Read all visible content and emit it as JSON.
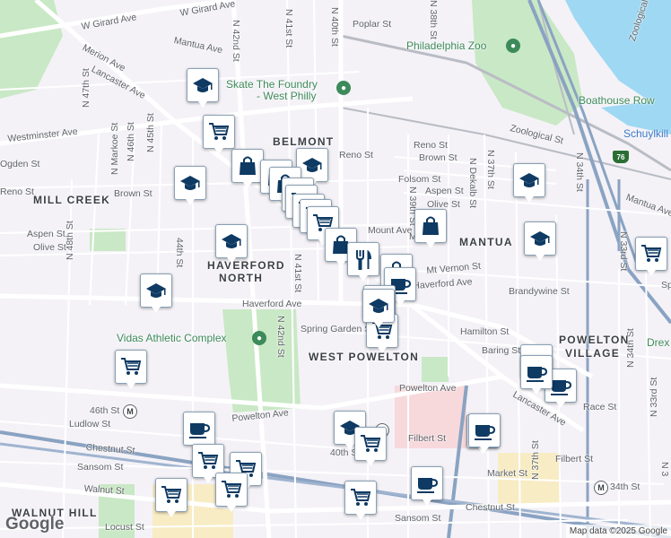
{
  "map": {
    "credits": "Map data ©2025 Google",
    "logo": "Google",
    "colors": {
      "background": "#f4f2f7",
      "park": "#c9e8c5",
      "water": "#9ed8f3",
      "major_road": "#ffffff",
      "highway": "#8aa3c2",
      "rail": "#b9bcc4",
      "marker_icon": "#0e3a63"
    },
    "street_labels": [
      "W Girard Ave",
      "W Girard Ave",
      "Mantua Ave",
      "Merion Ave",
      "Lancaster Ave",
      "Poplar St",
      "Westminster Ave",
      "Ogden St",
      "Reno St",
      "Brown St",
      "Folsom St",
      "Aspen St",
      "Olive St",
      "Mt Vernon St",
      "Haverford Ave",
      "Haverford Ave",
      "Brandywine St",
      "Spring Garden St",
      "Hamilton St",
      "Baring St",
      "Powelton Ave",
      "Powelton Ave",
      "Race St",
      "Lancaster Ave",
      "Ludlow St",
      "Chestnut St",
      "Filbert St",
      "Filbert St",
      "Sansom St",
      "Walnut St",
      "Locust St",
      "Market St",
      "Chestnut St",
      "Sansom St",
      "Zoological St",
      "Mantua Ave",
      "Brown St",
      "Spring",
      "Aspen St",
      "Olive St",
      "Reno St",
      "Reno St",
      "Mount Ave",
      "Mt",
      "N 48th St",
      "N 47th St",
      "N Markoe St",
      "N 46th St",
      "N 45th St",
      "44th St",
      "N 42nd St",
      "N 41st St",
      "N 40th St",
      "N 41st St",
      "N 42nd St",
      "N 39th St",
      "N Dekalb St",
      "N 37th St",
      "N 34th St",
      "N 33rd St",
      "N 34th St",
      "N 37th St",
      "N 33rd St",
      "46th St",
      "40th St",
      "34th St",
      "N 38th St",
      "Zoological",
      "N 3"
    ],
    "neighborhoods": [
      "BELMONT",
      "MILL CREEK",
      "HAVERFORD",
      "NORTH",
      "MANTUA",
      "WEST POWELTON",
      "POWELTON",
      "VILLAGE",
      "WALNUT HILL"
    ],
    "pois": [
      "Philadelphia Zoo",
      "Skate The Foundry",
      "- West Philly",
      "Vidas Athletic Complex",
      "Boathouse Row",
      "Drex"
    ],
    "water_labels": [
      "Schuylkill R"
    ],
    "stations": [
      {
        "label": "46th St",
        "badge": "M"
      },
      {
        "label": "40th St",
        "badge": "M"
      },
      {
        "label": "34th St",
        "badge": "M"
      }
    ],
    "highway_shield": "76",
    "markers": [
      {
        "type": "school"
      },
      {
        "type": "grocery"
      },
      {
        "type": "shopping"
      },
      {
        "type": "school"
      },
      {
        "type": "shopping"
      },
      {
        "type": "shopping"
      },
      {
        "type": "school"
      },
      {
        "type": "grocery"
      },
      {
        "type": "grocery"
      },
      {
        "type": "grocery"
      },
      {
        "type": "grocery"
      },
      {
        "type": "grocery"
      },
      {
        "type": "shopping"
      },
      {
        "type": "restaurant"
      },
      {
        "type": "shopping"
      },
      {
        "type": "cafe"
      },
      {
        "type": "school"
      },
      {
        "type": "grocery"
      },
      {
        "type": "school"
      },
      {
        "type": "school"
      },
      {
        "type": "school"
      },
      {
        "type": "shopping"
      },
      {
        "type": "school"
      },
      {
        "type": "grocery"
      },
      {
        "type": "grocery"
      },
      {
        "type": "cafe"
      },
      {
        "type": "cafe"
      },
      {
        "type": "cafe"
      },
      {
        "type": "school"
      },
      {
        "type": "cafe"
      },
      {
        "type": "grocery"
      },
      {
        "type": "grocery"
      },
      {
        "type": "grocery"
      },
      {
        "type": "grocery"
      },
      {
        "type": "grocery"
      },
      {
        "type": "cafe"
      },
      {
        "type": "cafe"
      },
      {
        "type": "cafe"
      },
      {
        "type": "grocery"
      },
      {
        "type": "school"
      }
    ]
  }
}
